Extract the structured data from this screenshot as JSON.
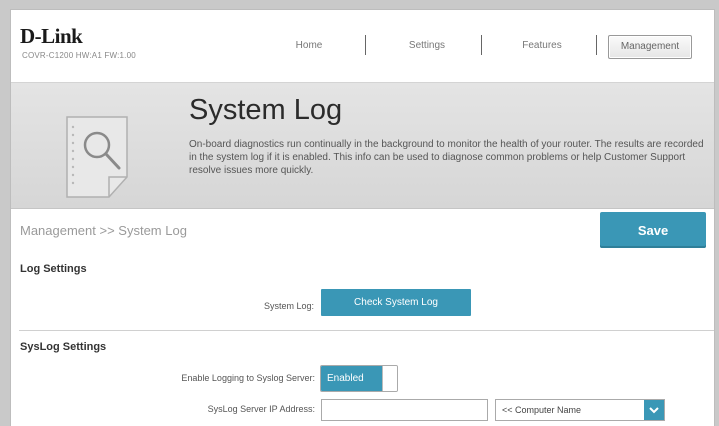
{
  "brand": {
    "logo": "D-Link",
    "model": "COVR-C1200 HW:A1 FW:1.00"
  },
  "nav": {
    "home": "Home",
    "settings": "Settings",
    "features": "Features",
    "management": "Management",
    "active": "Management"
  },
  "banner": {
    "title": "System Log",
    "description": "On-board diagnostics run continually in the background to monitor the health of your router. The results are recorded in the system log if it is enabled. This info can be used to diagnose common problems or help Customer Support resolve issues more quickly.",
    "icon": "document-magnifier-icon"
  },
  "breadcrumb": "Management >> System Log",
  "save_label": "Save",
  "log_settings": {
    "title": "Log Settings",
    "system_log_label": "System Log:",
    "check_button": "Check System Log"
  },
  "syslog_settings": {
    "title": "SysLog Settings",
    "enable_label": "Enable Logging to Syslog Server:",
    "enable_value": "Enabled",
    "ip_label": "SysLog Server IP Address:",
    "ip_value": "",
    "computer_select": "<< Computer Name"
  },
  "colors": {
    "accent": "#3a97b6",
    "banner_bg": "#dcdcdc",
    "page_bg": "#c9c9c9"
  }
}
